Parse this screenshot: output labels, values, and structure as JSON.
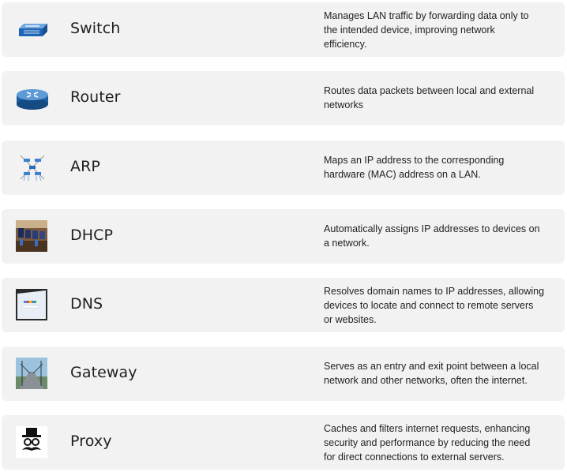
{
  "rows": [
    {
      "name": "Switch",
      "icon": "network-switch-icon",
      "description": "Manages LAN traffic by forwarding data only to\nthe intended device, improving network\nefficiency."
    },
    {
      "name": "Router",
      "icon": "router-icon",
      "description": "Routes data packets between local and external\nnetworks"
    },
    {
      "name": "ARP",
      "icon": "network-nodes-icon",
      "description": "Maps an IP address to the corresponding\nhardware (MAC) address on a LAN."
    },
    {
      "name": "DHCP",
      "icon": "computer-lab-photo-icon",
      "description": "Automatically assigns IP addresses to devices on\na network."
    },
    {
      "name": "DNS",
      "icon": "browser-search-photo-icon",
      "description": "Resolves domain names to IP addresses, allowing\ndevices to locate and connect to remote servers\nor websites."
    },
    {
      "name": "Gateway",
      "icon": "bridge-photo-icon",
      "description": "Serves as an entry and exit point between a local\nnetwork and other networks, often the internet."
    },
    {
      "name": "Proxy",
      "icon": "incognito-hat-mustache-icon",
      "description": " Caches and filters internet requests, enhancing\nsecurity and performance by reducing the need\nfor direct connections to external servers."
    }
  ]
}
